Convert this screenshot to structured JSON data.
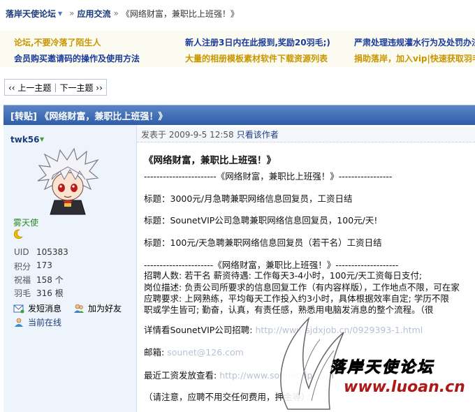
{
  "breadcrumb": {
    "forum": "落岸天使论坛",
    "separator": "»",
    "section": "应用交流",
    "current": "《网络财富，兼职比上班强！》"
  },
  "announcements": [
    {
      "text": "论坛,不要冷落了陌生人",
      "color": "#c89600"
    },
    {
      "text": "新人注册3日内在此报到,奖励20羽毛;)",
      "color": "#1a3a9a"
    },
    {
      "text": "严肃处理违规灌水行为及处罚办法",
      "color": "#1a3a9a"
    },
    {
      "text": "会员购买邀请码的操作及使用方法",
      "color": "#1a3a9a"
    },
    {
      "text": "大量的相册模板素材软件下载资源列表",
      "color": "#c89600"
    },
    {
      "text": "捐助落岸，加入vip|快速获取羽毛",
      "color": "#c89600"
    }
  ],
  "pager": {
    "prev": "‹‹ 上一主题",
    "divider": "|",
    "next": "下一主题 ››"
  },
  "thread": {
    "title": "[转贴] 《网络财富，兼职比上班强！》"
  },
  "user": {
    "name": "twk56",
    "rank": "雾天使",
    "stats": [
      {
        "label": "UID",
        "value": "105383"
      },
      {
        "label": "积分",
        "value": "173"
      },
      {
        "label": "祝福",
        "value": "158 个"
      },
      {
        "label": "羽毛",
        "value": "316 根"
      }
    ],
    "actions": {
      "message": "发短消息",
      "friend": "加为好友",
      "online": "当前在线"
    }
  },
  "post": {
    "posted_at": "发表于 2009-9-5 12:58",
    "only_author": "只看该作者",
    "lines": [
      "《网络财富，兼职比上班强！》",
      "-----------------------《网络财富，兼职比上班强！》-----------------",
      "标题：3000元/月急聘兼职网络信息回复员，工资日结",
      "标题：SounetVIP公司急聘兼职网络信息回复员，100元/天!",
      "标题：100元/天急聘兼职网络信息回复员（若干名）工资日结",
      "----------------------《网络财富，兼职比上班强！》--------------------",
      "招聘人数: 若干名      薪资待遇: 工作每天3-4小时，100元/天工资每日支付;",
      "岗位描述: 负责公司所要求的信息回复工作（有内容样版），工作地点不限，可在家",
      "应聘要求: 上网熟练，平均每天工作投入约3小时，具体根据效率自定;  学历不限",
      "职或学生皆可; 勤奋，认真，有责任感，熟悉用电脑发消息的整个流程。（很",
      "详情看SounetVIP公司招聘:",
      "邮箱:",
      "最近工资发放查看:",
      "（请注意，应聘不用交任何费用，押金等）"
    ],
    "blurred": {
      "link": "http://www.sjdxjob.cn/0929393-1.html",
      "email": "sounet@126.com",
      "salary": "http://www.sounetvip.com"
    }
  },
  "watermark": {
    "title": "落岸天使论坛",
    "url": "www.luoan.cn"
  }
}
